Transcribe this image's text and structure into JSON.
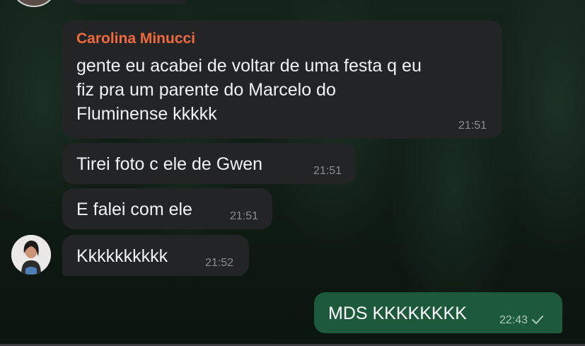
{
  "messages": [
    {
      "sender": "Carolina Minucci",
      "lines": [
        "gente eu acabei de voltar de uma festa q eu",
        "fiz pra um parente do Marcelo do",
        "Fluminense kkkkk"
      ],
      "time": "21:51"
    },
    {
      "text": "Tirei foto c ele de Gwen",
      "time": "21:51"
    },
    {
      "text": "E falei com ele",
      "time": "21:51"
    },
    {
      "text": "Kkkkkkkkkk",
      "time": "21:52"
    }
  ],
  "outgoing": {
    "text": "MDS KKKKKKKK",
    "time": "22:43",
    "status_icon": "single-check-icon"
  },
  "colors": {
    "incoming_bubble": "#232425",
    "outgoing_bubble": "#1d5a3b",
    "sender_name": "#ef6a3a",
    "timestamp": "#8c8d8f"
  }
}
